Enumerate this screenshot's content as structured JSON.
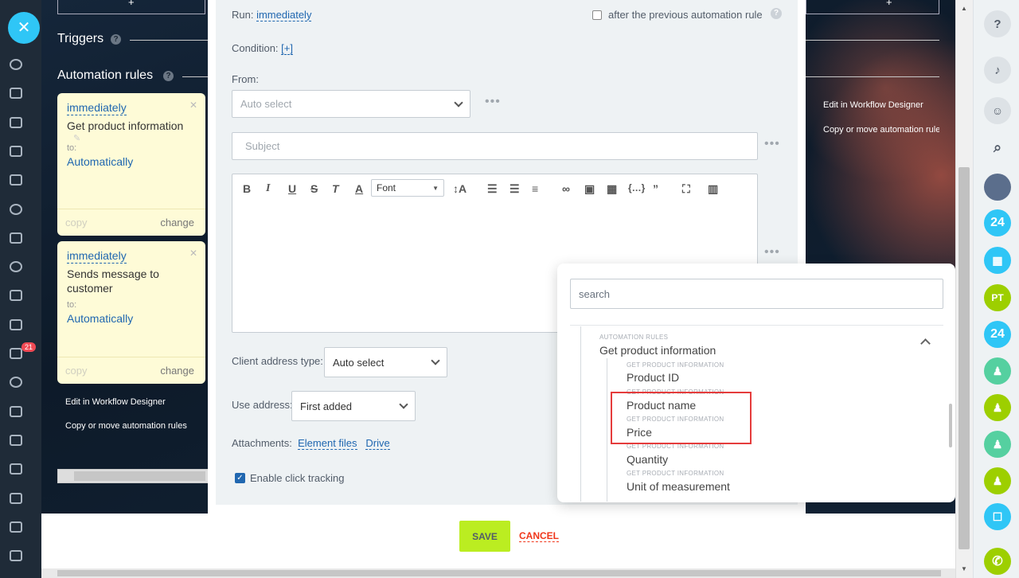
{
  "sections": {
    "triggers": "Triggers",
    "automation_rules": "Automation rules"
  },
  "cards": [
    {
      "run": "immediately",
      "title": "Get product information",
      "to": "to:",
      "target": "Automatically",
      "copy": "copy",
      "change": "change"
    },
    {
      "run": "immediately",
      "title": "Sends message to customer",
      "to": "to:",
      "target": "Automatically",
      "copy": "copy",
      "change": "change"
    }
  ],
  "links": {
    "edit_designer": "Edit in Workflow Designer",
    "copy_move": "Copy or move automation rules",
    "copy_move_right": "Copy or move automation rule"
  },
  "form": {
    "run_label": "Run:",
    "run_value": "immediately",
    "after_previous": "after the previous automation rule",
    "condition_label": "Condition:",
    "condition_value": "[+]",
    "from_label": "From:",
    "from_value": "Auto select",
    "subject_placeholder": "Subject",
    "font_label": "Font",
    "client_address_label": "Client address type:",
    "client_address_value": "Auto select",
    "use_address_label": "Use address:",
    "use_address_value": "First added",
    "attachments_label": "Attachments:",
    "element_files": "Element files",
    "drive": "Drive",
    "click_tracking": "Enable click tracking",
    "save": "SAVE",
    "cancel": "CANCEL"
  },
  "popup": {
    "search_placeholder": "search",
    "group_category": "AUTOMATION RULES",
    "group_name": "Get product information",
    "items": [
      {
        "category": "GET PRODUCT INFORMATION",
        "name": "Product ID"
      },
      {
        "category": "GET PRODUCT INFORMATION",
        "name": "Product name"
      },
      {
        "category": "GET PRODUCT INFORMATION",
        "name": "Price"
      },
      {
        "category": "GET PRODUCT INFORMATION",
        "name": "Quantity"
      },
      {
        "category": "GET PRODUCT INFORMATION",
        "name": "Unit of measurement"
      }
    ]
  },
  "sidebar": {
    "badge": "21",
    "avatar_initials": "PT",
    "b24": "24"
  },
  "colors": {
    "accent": "#2067b0",
    "save_green": "#bbed21",
    "highlight": "#e53c3c",
    "close_blue": "#2fc6f6"
  }
}
